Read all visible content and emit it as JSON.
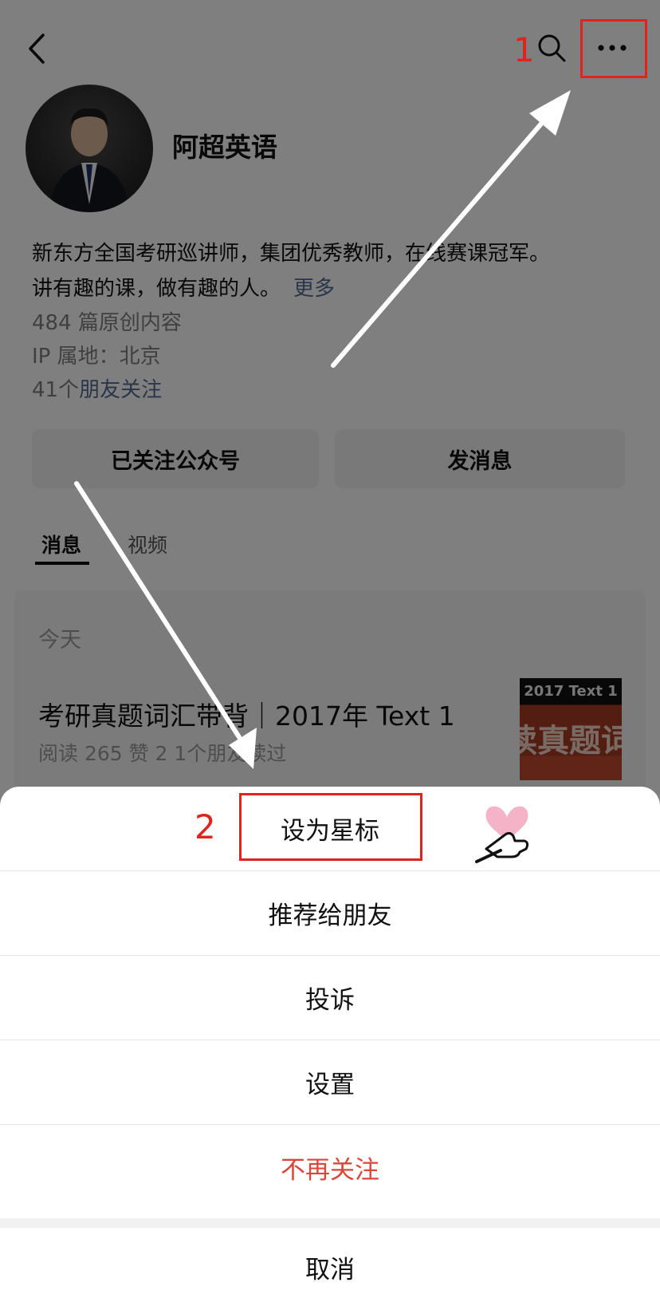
{
  "header": {
    "back_icon": "back-arrow-icon",
    "search_icon": "search-icon",
    "more_icon": "more-dots-icon"
  },
  "profile": {
    "name": "阿超英语",
    "bio_line1": "新东方全国考研巡讲师，集团优秀教师，在线赛课冠军。",
    "bio_line2": "讲有趣的课，做有趣的人。",
    "bio_more": "更多",
    "original_count": "484 篇原创内容",
    "ip_location": "IP 属地：北京",
    "friends_count_prefix": "41个",
    "friends_link": "朋友关注"
  },
  "buttons": {
    "followed": "已关注公众号",
    "send_message": "发消息"
  },
  "tabs": [
    {
      "label": "消息",
      "active": true
    },
    {
      "label": "视频",
      "active": false
    }
  ],
  "feed": {
    "date_label": "今天",
    "articles": [
      {
        "title": "考研真题词汇带背｜2017年 Text 1",
        "meta": "阅读 265  赞 2  1个朋友读过",
        "thumbnail_caption": "2017 Text 1",
        "thumbnail_text": "读真题词"
      }
    ]
  },
  "annotations": {
    "step1": "1",
    "step2": "2",
    "color": "#e0231c"
  },
  "action_sheet": {
    "items": [
      {
        "label": "设为星标"
      },
      {
        "label": "推荐给朋友"
      },
      {
        "label": "投诉"
      },
      {
        "label": "设置"
      },
      {
        "label": "不再关注",
        "color": "#d9473a"
      }
    ],
    "cancel": "取消"
  },
  "colors": {
    "link": "#576b95",
    "danger": "#d9473a",
    "overlay": "rgba(0,0,0,0.5)"
  }
}
